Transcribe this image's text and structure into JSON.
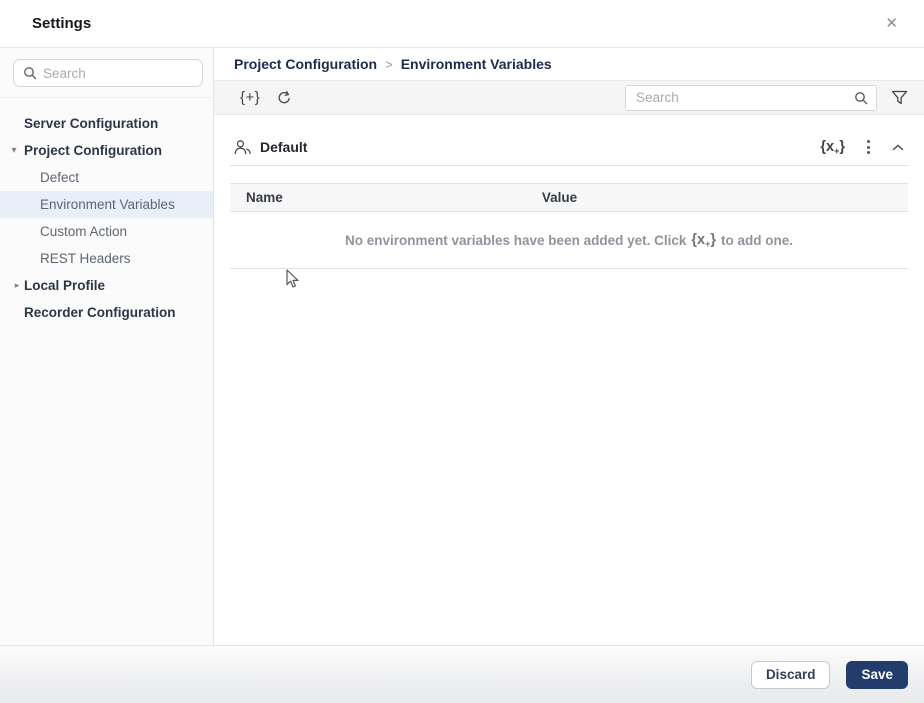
{
  "dialog": {
    "title": "Settings",
    "close_glyph": "✕"
  },
  "sidebar": {
    "search": {
      "placeholder": "Search",
      "value": ""
    },
    "items": [
      {
        "label": "Server Configuration",
        "level": 0
      },
      {
        "label": "Project Configuration",
        "level": 0,
        "expanded": true,
        "expander": "▾"
      },
      {
        "label": "Defect",
        "level": 1
      },
      {
        "label": "Environment Variables",
        "level": 1,
        "selected": true
      },
      {
        "label": "Custom Action",
        "level": 1
      },
      {
        "label": "REST Headers",
        "level": 1
      },
      {
        "label": "Local Profile",
        "level": 0,
        "collapsed": true,
        "expander": "▸"
      },
      {
        "label": "Recorder Configuration",
        "level": 0
      }
    ]
  },
  "main": {
    "breadcrumb": {
      "crumbs": [
        "Project Configuration",
        "Environment Variables"
      ],
      "separator": ">"
    },
    "toolbar": {
      "add_set_glyph": "{+}",
      "search": {
        "placeholder": "Search",
        "value": ""
      }
    },
    "section": {
      "title": "Default",
      "add_variable_glyph": {
        "open": "{x",
        "sub": "+",
        "close": "}"
      },
      "table": {
        "columns": [
          "Name",
          "Value"
        ],
        "rows": [],
        "empty_prefix": "No environment variables have been added yet. Click",
        "empty_suffix": "to add one."
      }
    }
  },
  "footer": {
    "discard_label": "Discard",
    "save_label": "Save"
  },
  "colors": {
    "accent_navy": "#223c6d",
    "breadcrumb_text": "#1c2b50",
    "selected_item_bg": "#e9eff8",
    "toolbar_bg": "#f5f5f6",
    "table_header_bg": "#f7f7f8"
  }
}
